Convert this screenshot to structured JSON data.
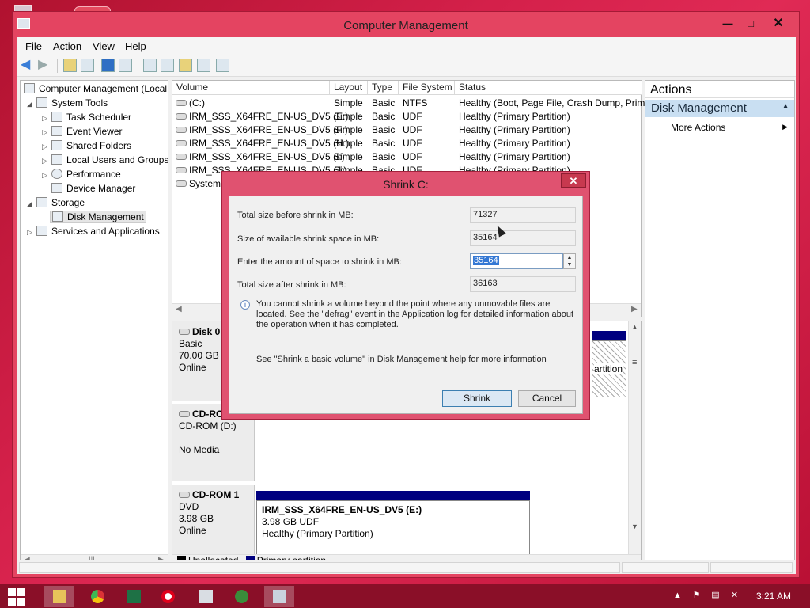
{
  "window": {
    "title": "Computer Management",
    "controls": {
      "minimize": "—",
      "maximize": "□",
      "close": "✕"
    }
  },
  "menu": [
    "File",
    "Action",
    "View",
    "Help"
  ],
  "toolbar_icons": [
    "back-arrow-icon",
    "forward-arrow-icon",
    "up-folder-icon",
    "show-hide-tree-icon",
    "help-icon",
    "properties-icon",
    "refresh-icon",
    "export-icon",
    "open-icon",
    "find-icon",
    "settings-icon"
  ],
  "tree": {
    "root": "Computer Management (Local",
    "system_tools": "System Tools",
    "items": [
      "Task Scheduler",
      "Event Viewer",
      "Shared Folders",
      "Local Users and Groups",
      "Performance",
      "Device Manager"
    ],
    "storage": "Storage",
    "disk_management": "Disk Management",
    "services": "Services and Applications"
  },
  "volume_list": {
    "columns": [
      "Volume",
      "Layout",
      "Type",
      "File System",
      "Status"
    ],
    "rows": [
      {
        "volume": "(C:)",
        "layout": "Simple",
        "type": "Basic",
        "fs": "NTFS",
        "status": "Healthy (Boot, Page File, Crash Dump, Prima"
      },
      {
        "volume": "IRM_SSS_X64FRE_EN-US_DV5 (E:)",
        "layout": "Simple",
        "type": "Basic",
        "fs": "UDF",
        "status": "Healthy (Primary Partition)"
      },
      {
        "volume": "IRM_SSS_X64FRE_EN-US_DV5 (F:)",
        "layout": "Simple",
        "type": "Basic",
        "fs": "UDF",
        "status": "Healthy (Primary Partition)"
      },
      {
        "volume": "IRM_SSS_X64FRE_EN-US_DV5 (H:)",
        "layout": "Simple",
        "type": "Basic",
        "fs": "UDF",
        "status": "Healthy (Primary Partition)"
      },
      {
        "volume": "IRM_SSS_X64FRE_EN-US_DV5 (I:)",
        "layout": "Simple",
        "type": "Basic",
        "fs": "UDF",
        "status": "Healthy (Primary Partition)"
      },
      {
        "volume": "IRM_SSS_X64FRE_EN-US_DV5 (J:)",
        "layout": "Simple",
        "type": "Basic",
        "fs": "UDF",
        "status": "Healthy (Primary Partition)"
      },
      {
        "volume": "System R",
        "layout": "",
        "type": "",
        "fs": "",
        "status": "y Partition)"
      }
    ]
  },
  "disks": {
    "disk0": {
      "name": "Disk 0",
      "type": "Basic",
      "size": "70.00 GB",
      "state": "Online",
      "partition_tail": "artition"
    },
    "cdrom0": {
      "name": "CD-RO",
      "drive": "CD-ROM (D:)",
      "media": "No Media"
    },
    "cdrom1": {
      "name": "CD-ROM 1",
      "type": "DVD",
      "size": "3.98 GB",
      "state": "Online",
      "volume_name": "IRM_SSS_X64FRE_EN-US_DV5  (E:)",
      "volume_size": "3.98 GB UDF",
      "volume_status": "Healthy (Primary Partition)"
    }
  },
  "legend": {
    "unallocated": "Unallocated",
    "primary": "Primary partition"
  },
  "actions": {
    "header": "Actions",
    "section": "Disk Management",
    "more": "More Actions"
  },
  "dialog": {
    "title": "Shrink C:",
    "total_before_label": "Total size before shrink in MB:",
    "total_before": "71327",
    "available_label": "Size of available shrink space in MB:",
    "available": "35164",
    "amount_label": "Enter the amount of space to shrink in MB:",
    "amount": "35164",
    "total_after_label": "Total size after shrink in MB:",
    "total_after": "36163",
    "note1": "You cannot shrink a volume beyond the point where any unmovable files are located. See the \"defrag\" event in the Application log for detailed information about the operation when it has completed.",
    "note2": "See \"Shrink a basic volume\" in Disk Management help for more information",
    "shrink_btn": "Shrink",
    "cancel_btn": "Cancel"
  },
  "taskbar": {
    "clock": "3:21 AM",
    "apps": [
      "file-explorer-icon",
      "chrome-icon",
      "excel-icon",
      "opera-icon",
      "document-icon",
      "globe-icon",
      "computer-management-icon"
    ]
  },
  "colors": {
    "accent": "#e44461",
    "primary_partition": "#00007f",
    "taskbar": "#8a0f28"
  }
}
